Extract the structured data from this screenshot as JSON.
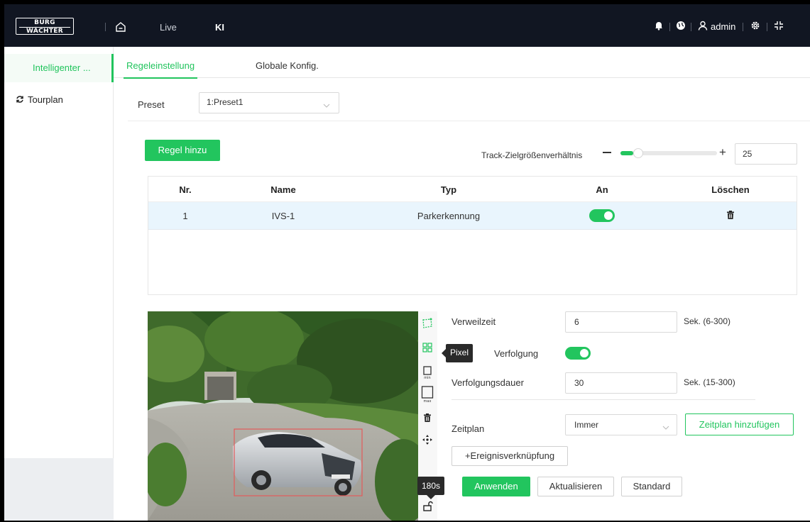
{
  "brand": {
    "line1": "BURG",
    "line2": "WÄCHTER"
  },
  "topnav": {
    "live": "Live",
    "ki": "KI",
    "user": "admin"
  },
  "icons": {
    "home": "home-icon",
    "bell": "bell-icon",
    "globe": "globe-icon",
    "user": "user-icon",
    "settings": "gear-icon",
    "fullscreen": "fullscreen-icon"
  },
  "sidebar": {
    "items": [
      {
        "label": "Intelligenter ...",
        "active": true
      },
      {
        "label": "Tourplan",
        "active": false
      }
    ]
  },
  "tabs": [
    {
      "label": "Regeleinstellung",
      "active": true
    },
    {
      "label": "Globale Konfig.",
      "active": false
    }
  ],
  "preset": {
    "label": "Preset",
    "value": "1:Preset1"
  },
  "rules": {
    "add_label": "Regel hinzu",
    "track_label": "Track-Zielgrößenverhältnis",
    "track_value": "25",
    "track_level_fraction": 0.13,
    "columns": [
      "Nr.",
      "Name",
      "Typ",
      "An",
      "Löschen"
    ],
    "rows": [
      {
        "nr": "1",
        "name": "IVS-1",
        "typ": "Parkerkennung",
        "an": true
      }
    ]
  },
  "toolbar": {
    "tooltip": "Pixel",
    "time": "180s"
  },
  "form": {
    "verweilzeit_label": "Verweilzeit",
    "verweilzeit_value": "6",
    "verweilzeit_unit": "Sek. (6-300)",
    "verfolgung_label": "Verfolgung",
    "verfolgung_on": true,
    "verfolgungsdauer_label": "Verfolgungsdauer",
    "verfolgungsdauer_value": "30",
    "verfolgungsdauer_unit": "Sek. (15-300)",
    "zeitplan_label": "Zeitplan",
    "zeitplan_value": "Immer",
    "zeitplan_add": "Zeitplan hinzufügen",
    "ereignis": "+Ereignisverknüpfung",
    "apply": "Anwenden",
    "refresh": "Aktualisieren",
    "default": "Standard"
  },
  "colors": {
    "accent": "#22c55e",
    "topbar": "#111622",
    "selected_row": "#e9f5fd"
  }
}
